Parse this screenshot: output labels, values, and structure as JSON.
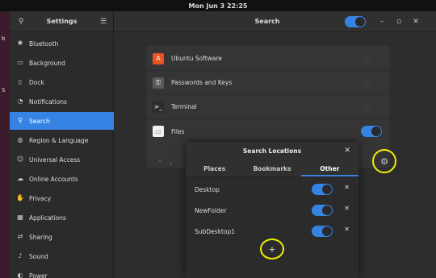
{
  "topbar": {
    "datetime": "Mon Jun 3  22:25"
  },
  "desktop": {
    "letters": [
      "b",
      "S"
    ]
  },
  "window": {
    "sidebar_title": "Settings",
    "main_title": "Search",
    "controls": {
      "minimize": "–",
      "maximize": "▫",
      "close": "✕"
    },
    "search_icon": "⚲",
    "menu_icon": "☰"
  },
  "sidebar": {
    "items": [
      {
        "label": "Bluetooth",
        "icon": "bluetooth-icon",
        "glyph": "✱"
      },
      {
        "label": "Background",
        "icon": "background-icon",
        "glyph": "▭"
      },
      {
        "label": "Dock",
        "icon": "dock-icon",
        "glyph": "▯"
      },
      {
        "label": "Notifications",
        "icon": "notifications-icon",
        "glyph": "◔"
      },
      {
        "label": "Search",
        "icon": "search-icon",
        "glyph": "⚲"
      },
      {
        "label": "Region & Language",
        "icon": "region-icon",
        "glyph": "◍"
      },
      {
        "label": "Universal Access",
        "icon": "accessibility-icon",
        "glyph": "☺"
      },
      {
        "label": "Online Accounts",
        "icon": "online-accounts-icon",
        "glyph": "☁"
      },
      {
        "label": "Privacy",
        "icon": "privacy-icon",
        "glyph": "✋"
      },
      {
        "label": "Applications",
        "icon": "applications-icon",
        "glyph": "▦"
      },
      {
        "label": "Sharing",
        "icon": "sharing-icon",
        "glyph": "⇄"
      },
      {
        "label": "Sound",
        "icon": "sound-icon",
        "glyph": "♪"
      },
      {
        "label": "Power",
        "icon": "power-icon",
        "glyph": "◐"
      }
    ],
    "active": "Search"
  },
  "search_list": {
    "rows": [
      {
        "label": "Ubuntu Software",
        "icon": "ubuntu-software-icon",
        "glyph": "A",
        "color": "#e95420",
        "enabled": false
      },
      {
        "label": "Passwords and Keys",
        "icon": "passwords-icon",
        "glyph": "⚿",
        "color": "#5a5a5a",
        "enabled": false
      },
      {
        "label": "Terminal",
        "icon": "terminal-icon",
        "glyph": ">_",
        "color": "#2c2c2c",
        "enabled": false
      },
      {
        "label": "Files",
        "icon": "files-icon",
        "glyph": "▭",
        "color": "#f0f0f0",
        "enabled": true
      }
    ],
    "up_arrow": "⌃",
    "down_arrow": "⌄",
    "gear": "⚙"
  },
  "dialog": {
    "title": "Search Locations",
    "close": "✕",
    "tabs": [
      "Places",
      "Bookmarks",
      "Other"
    ],
    "active_tab": "Other",
    "locations": [
      {
        "label": "Desktop",
        "enabled": true
      },
      {
        "label": "NewFolder",
        "enabled": true
      },
      {
        "label": "SubDesktop1",
        "enabled": true
      }
    ],
    "remove": "✕",
    "add": "+"
  },
  "colors": {
    "accent": "#3584e4",
    "highlight_ring": "#f0f000"
  }
}
